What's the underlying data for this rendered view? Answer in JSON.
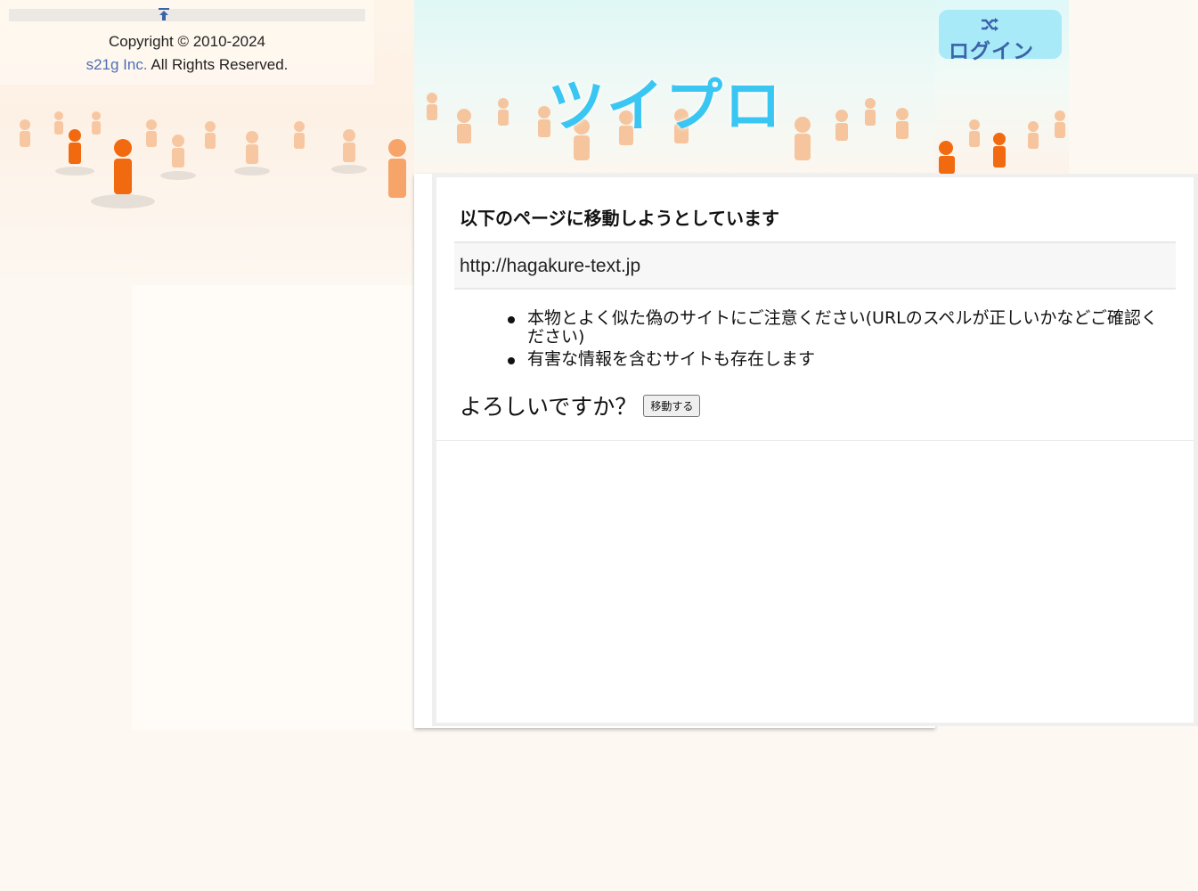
{
  "footer": {
    "copyright_line": "Copyright © 2010-2024",
    "company_link": "s21g Inc.",
    "rights": " All Rights Reserved."
  },
  "header": {
    "logo_text": "ツイプロ"
  },
  "login": {
    "label": "ログイン",
    "icon": "shuffle-icon"
  },
  "dialog": {
    "title": "以下のページに移動しようとしています",
    "url": "http://hagakure-text.jp",
    "warnings": [
      "本物とよく似た偽のサイトにご注意ください(URLのスペルが正しいかなどご確認ください)",
      "有害な情報を含むサイトも存在します"
    ],
    "confirm_question": "よろしいですか？",
    "move_button": "移動する"
  },
  "colors": {
    "logo": "#3ac6f2",
    "login_tab": "#a9eaf8",
    "link": "#4d6fb3",
    "figure_orange": "#f26a10"
  }
}
